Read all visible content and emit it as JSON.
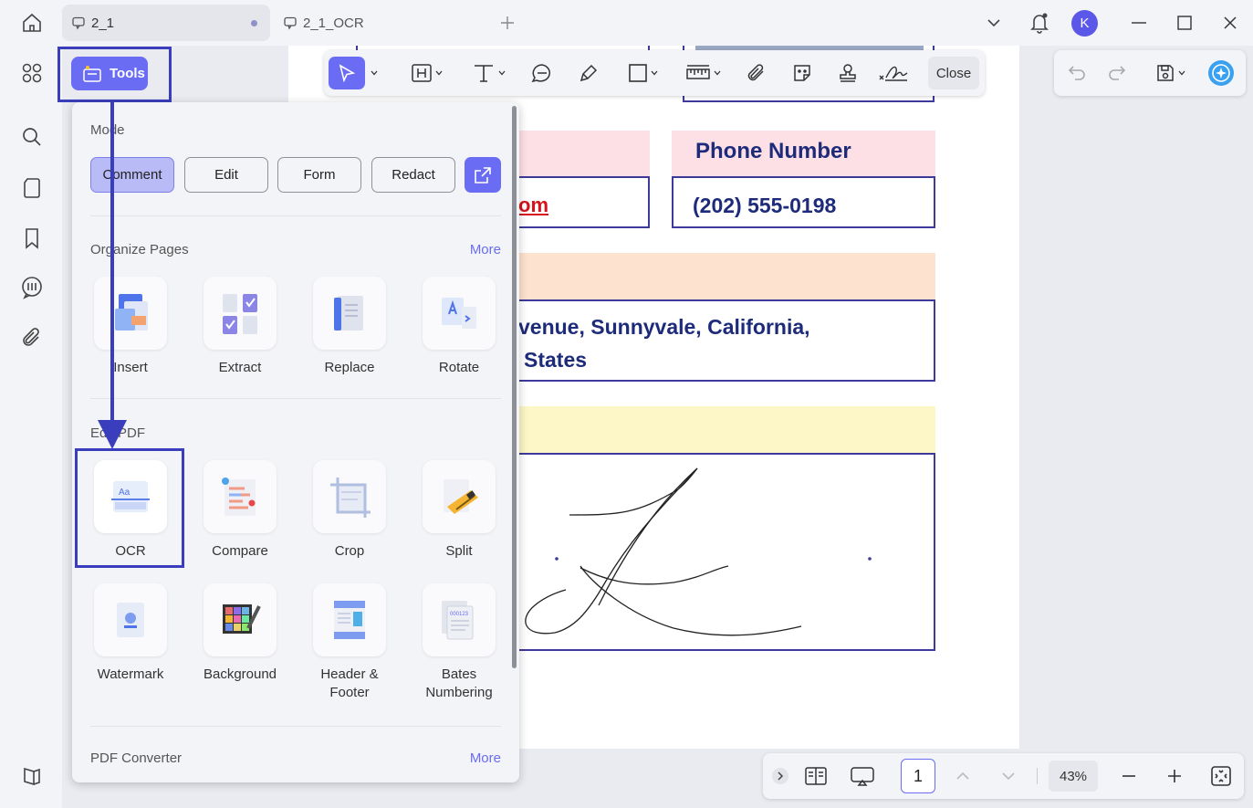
{
  "window": {
    "tabs": [
      {
        "label": "2_1",
        "active": true
      },
      {
        "label": "2_1_OCR",
        "active": false
      }
    ],
    "avatar_initial": "K"
  },
  "toolbar": {
    "tools_label": "Tools",
    "close_label": "Close"
  },
  "panel": {
    "mode": {
      "title": "Mode",
      "buttons": [
        "Comment",
        "Edit",
        "Form",
        "Redact"
      ],
      "active": "Comment"
    },
    "organize": {
      "title": "Organize Pages",
      "more": "More",
      "items": [
        "Insert",
        "Extract",
        "Replace",
        "Rotate"
      ]
    },
    "edit_pdf": {
      "title": "Edit PDF",
      "items": [
        "OCR",
        "Compare",
        "Crop",
        "Split",
        "Watermark",
        "Background",
        "Header &",
        "Footer",
        "Bates",
        "Numbering"
      ]
    },
    "converter": {
      "title": "PDF Converter",
      "more": "More"
    }
  },
  "document": {
    "phone_heading": "Phone Number",
    "phone_value": "(202) 555-0198",
    "email_fragment": "om",
    "address_line1": "venue, Sunnyvale, California,",
    "address_line2": "States"
  },
  "bottom": {
    "page_number": "1",
    "zoom": "43%"
  },
  "colors": {
    "accent": "#6a6cf3",
    "highlight_border": "#3b3ebc",
    "pink_band": "#fde0e6",
    "peach_band": "#fde3cf",
    "yellow_band": "#fdf6c6",
    "box_border": "#3e3a9c"
  }
}
